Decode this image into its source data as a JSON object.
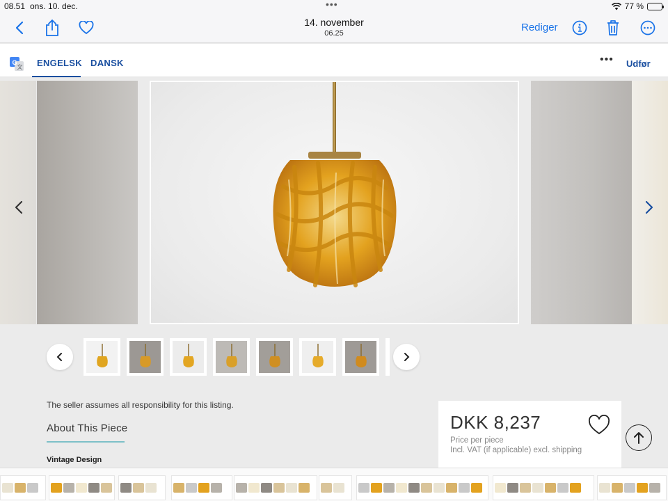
{
  "status_bar": {
    "time": "08.51",
    "date": "ons. 10. dec.",
    "battery": "77 %",
    "battery_level": 0.77
  },
  "toolbar": {
    "title": "14. november",
    "subtitle": "06.25",
    "edit_label": "Rediger"
  },
  "translate_bar": {
    "tabs": [
      {
        "label": "ENGELSK",
        "active": true
      },
      {
        "label": "DANSK",
        "active": false
      }
    ],
    "done_label": "Udfør"
  },
  "thumbnails": [
    {
      "bg": "#f2f2f2",
      "lamp": "#e0a520"
    },
    {
      "bg": "#9c9894",
      "lamp": "#d79a28"
    },
    {
      "bg": "#ececec",
      "lamp": "#e3a622"
    },
    {
      "bg": "#bdbab6",
      "lamp": "#d9a02a"
    },
    {
      "bg": "#a29e99",
      "lamp": "#cf8f22"
    },
    {
      "bg": "#efefef",
      "lamp": "#e6ab2a"
    },
    {
      "bg": "#9e9a96",
      "lamp": "#d08b1f"
    }
  ],
  "listing": {
    "seller_note": "The seller assumes all responsibility for this listing.",
    "about_heading": "About This Piece",
    "vintage_label": "Vintage Design"
  },
  "price": {
    "amount": "DKK 8,237",
    "per_piece": "Price per piece",
    "vat_note": "Incl. VAT (if applicable) excl. shipping"
  },
  "colors": {
    "accent": "#1a73e8",
    "tab_blue": "#1a4fa0",
    "amber": "#e3a21f",
    "underline_teal": "#7cc0c8"
  }
}
